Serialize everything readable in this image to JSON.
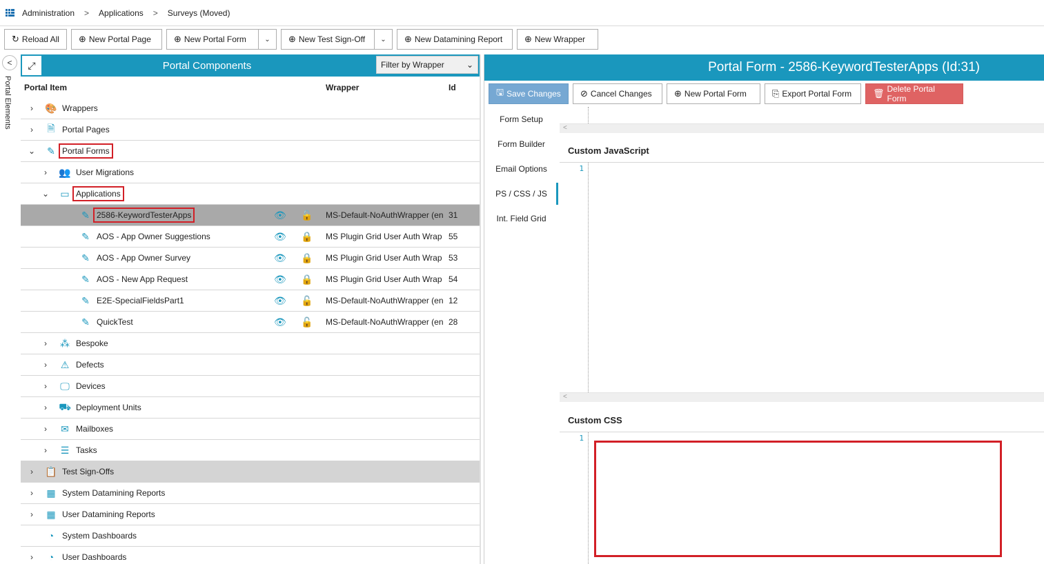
{
  "breadcrumb": [
    "Administration",
    "Applications",
    "Surveys (Moved)"
  ],
  "toolbar": {
    "reload": "Reload All",
    "new_page": "New Portal Page",
    "new_form": "New Portal Form",
    "new_test": "New Test Sign-Off",
    "new_report": "New Datamining Report",
    "new_wrapper": "New Wrapper"
  },
  "sidetab": "Portal Elements",
  "left": {
    "title": "Portal Components",
    "filter": "Filter by Wrapper",
    "col_item": "Portal Item",
    "col_wrapper": "Wrapper",
    "col_id": "Id",
    "rows": [
      {
        "label": "Wrappers",
        "icon": "palette-icon"
      },
      {
        "label": "Portal Pages",
        "icon": "page-icon"
      },
      {
        "label": "Portal Forms",
        "icon": "form-icon"
      },
      {
        "label": "User Migrations",
        "icon": "users-icon"
      },
      {
        "label": "Applications",
        "icon": "window-icon"
      },
      {
        "label": "2586-KeywordTesterApps",
        "wrapper": "MS-Default-NoAuthWrapper (en",
        "id": "31"
      },
      {
        "label": "AOS - App Owner Suggestions",
        "wrapper": "MS Plugin Grid User Auth Wrap",
        "id": "55"
      },
      {
        "label": "AOS - App Owner Survey",
        "wrapper": "MS Plugin Grid User Auth Wrap",
        "id": "53"
      },
      {
        "label": "AOS - New App Request",
        "wrapper": "MS Plugin Grid User Auth Wrap",
        "id": "54"
      },
      {
        "label": "E2E-SpecialFieldsPart1",
        "wrapper": "MS-Default-NoAuthWrapper (en",
        "id": "12"
      },
      {
        "label": "QuickTest",
        "wrapper": "MS-Default-NoAuthWrapper (en",
        "id": "28"
      },
      {
        "label": "Bespoke",
        "icon": "cubes-icon"
      },
      {
        "label": "Defects",
        "icon": "warning-icon"
      },
      {
        "label": "Devices",
        "icon": "monitor-icon"
      },
      {
        "label": "Deployment Units",
        "icon": "truck-icon"
      },
      {
        "label": "Mailboxes",
        "icon": "mailbox-icon"
      },
      {
        "label": "Tasks",
        "icon": "tasks-icon"
      },
      {
        "label": "Test Sign-Offs",
        "icon": "clipboard-icon"
      },
      {
        "label": "System Datamining Reports",
        "icon": "grid-icon"
      },
      {
        "label": "User Datamining Reports",
        "icon": "grid-icon"
      },
      {
        "label": "System Dashboards",
        "icon": "dashboard-icon"
      },
      {
        "label": "User Dashboards",
        "icon": "dashboard-icon"
      }
    ]
  },
  "right": {
    "title": "Portal Form -  2586-KeywordTesterApps  (Id:31)",
    "save": "Save Changes",
    "cancel": "Cancel Changes",
    "new_form": "New Portal Form",
    "export": "Export Portal Form",
    "delete": "Delete Portal Form",
    "tabs": [
      "Form Setup",
      "Form Builder",
      "Email Options",
      "PS / CSS / JS",
      "Int. Field Grid"
    ],
    "js_label": "Custom JavaScript",
    "css_label": "Custom CSS",
    "line_num": "1"
  },
  "colors": {
    "accent": "#1a97bd",
    "highlight": "#d21f26",
    "save": "#76a8d3",
    "delete": "#df6363"
  }
}
